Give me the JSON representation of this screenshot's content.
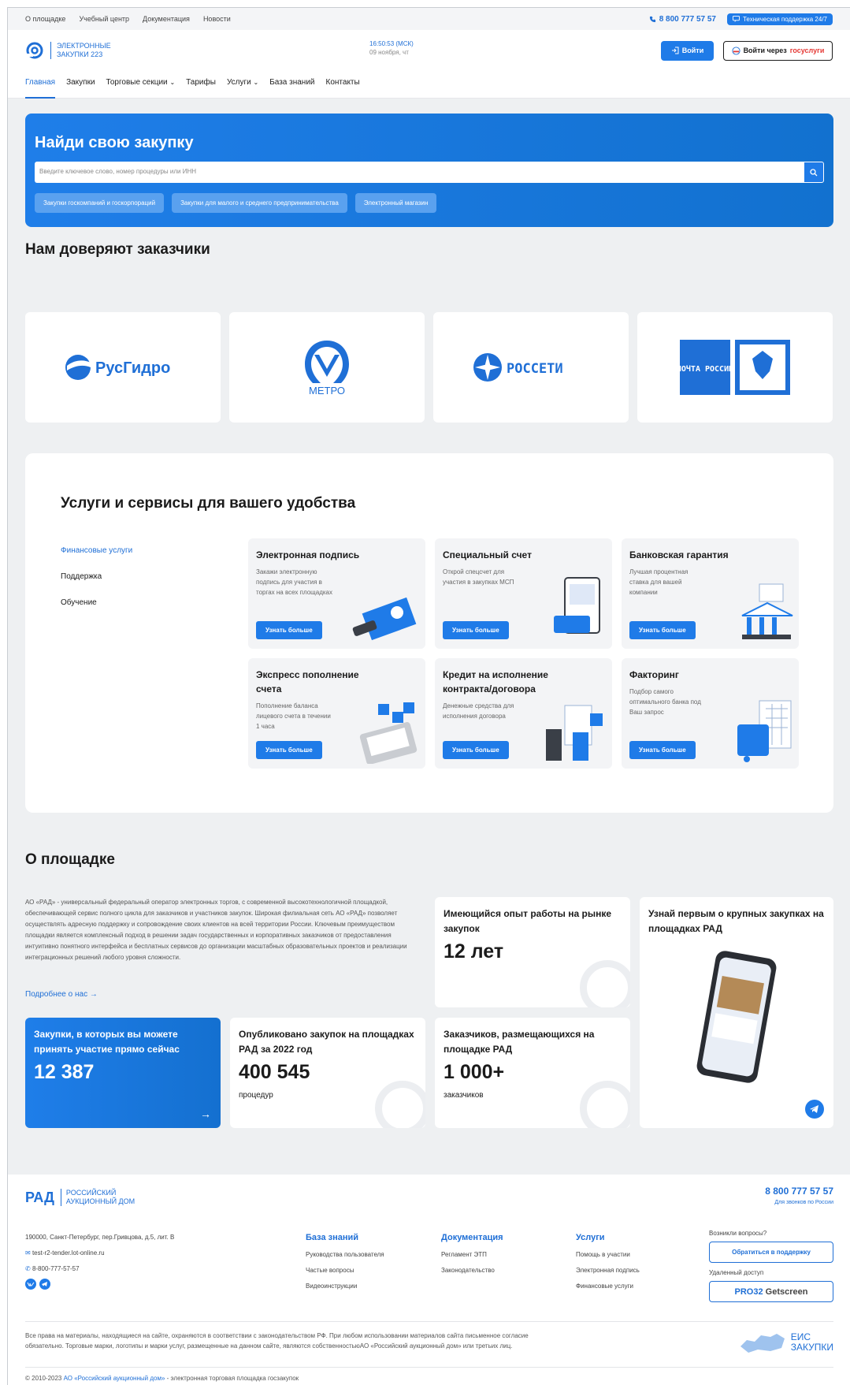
{
  "topbar": {
    "links": [
      "О площадке",
      "Учебный центр",
      "Документация",
      "Новости"
    ],
    "phone": "8 800 777 57 57",
    "support": "Техническая поддержка 24/7"
  },
  "header": {
    "logo_line1": "ЭЛЕКТРОННЫЕ",
    "logo_line2": "ЗАКУПКИ 223",
    "time": "16:50:53 (МСК)",
    "date": "09 ноября, чт",
    "login": "Войти",
    "gos_prefix": "Войти через",
    "gos_brand": "госуслуги"
  },
  "nav": [
    "Главная",
    "Закупки",
    "Торговые секции",
    "Тарифы",
    "Услуги",
    "База знаний",
    "Контакты"
  ],
  "hero": {
    "title": "Найди свою закупку",
    "placeholder": "Введите ключевое слово, номер процедуры или ИНН",
    "chips": [
      "Закупки госкомпаний и госкорпораций",
      "Закупки для малого и среднего предпринимательства",
      "Электронный магазин"
    ]
  },
  "partners": {
    "title": "Нам доверяют заказчики",
    "items": [
      {
        "label": "РусГидро",
        "icon": "rushydro-logo"
      },
      {
        "label": "МЕТРО",
        "icon": "metro-logo"
      },
      {
        "label": "РОССЕТИ",
        "icon": "rosseti-logo"
      },
      {
        "label": "ПОЧТА РОССИИ",
        "icon": "pochta-logo"
      }
    ]
  },
  "services": {
    "title": "Услуги и сервисы для вашего удобства",
    "tabs": [
      "Финансовые услуги",
      "Поддержка",
      "Обучение"
    ],
    "more_label": "Узнать больше",
    "cards": [
      {
        "title": "Электронная подпись",
        "desc": "Закажи электронную подпись для участия в торгах на всех площадках"
      },
      {
        "title": "Специальный счет",
        "desc": "Открой спецсчет для участия в закупках МСП"
      },
      {
        "title": "Банковская гарантия",
        "desc": "Лучшая процентная ставка для вашей компании"
      },
      {
        "title": "Экспресс пополнение счета",
        "desc": "Пополнение баланса лицевого счета в течении 1 часа"
      },
      {
        "title": "Кредит на исполнение контракта/договора",
        "desc": "Денежные средства для исполнения договора"
      },
      {
        "title": "Факторинг",
        "desc": "Подбор самого оптимального банка под Ваш запрос"
      }
    ]
  },
  "about": {
    "title": "О площадке",
    "text": "АО «РАД» - универсальный федеральный оператор электронных торгов, с современной высокотехнологичной площадкой, обеспечивающей сервис полного цикла для заказчиков и участников закупок. Широкая филиальная сеть АО «РАД» позволяет осуществлять адресную поддержку и сопровождение своих клиентов на всей территории России. Ключевым преимуществом площадки является комплексный подход в решении задач государственных и корпоративных заказчиков от предоставления интуитивно понятного интерфейса и бесплатных сервисов до организации масштабных образовательных проектов и реализации интеграционных решений любого уровня сложности.",
    "link": "Подробнее о нас",
    "experience_caption": "Имеющийся опыт работы на рынке закупок",
    "experience_value": "12 лет",
    "promo_caption": "Узнай первым о крупных закупках на площадках РАД",
    "now_caption": "Закупки, в которых вы можете принять участие прямо сейчас",
    "now_value": "12 387",
    "published_caption": "Опубликовано закупок на площадках РАД за 2022 год",
    "published_value": "400 545",
    "published_unit": "процедур",
    "customers_caption": "Заказчиков, размещающихся на площадке РАД",
    "customers_value": "1 000+",
    "customers_unit": "заказчиков"
  },
  "footer": {
    "logo_mark": "РАД",
    "logo_line1": "РОССИЙСКИЙ",
    "logo_line2": "АУКЦИОННЫЙ ДОМ",
    "phone": "8 800 777 57 57",
    "phone_note": "Для звонков по России",
    "address": "190000, Санкт-Петербург, пер.Гривцова, д.5, лит. В",
    "email": "test-r2-tender.lot-online.ru",
    "tel": "8-800-777-57-57",
    "cols": [
      {
        "title": "База знаний",
        "items": [
          "Руководства пользователя",
          "Частые вопросы",
          "Видеоинструкции"
        ]
      },
      {
        "title": "Документация",
        "items": [
          "Регламент ЭТП",
          "Законодательство"
        ]
      },
      {
        "title": "Услуги",
        "items": [
          "Помощь в участии",
          "Электронная подпись",
          "Финансовые услуги"
        ]
      }
    ],
    "questions": "Возникли вопросы?",
    "support_btn": "Обратиться в поддержку",
    "remote": "Удаленный доступ",
    "pro": "PRO32",
    "getscreen": "Getscreen",
    "legal": "Все права на материалы, находящиеся на сайте, охраняются в соответствии с законодательством РФ. При любом использовании материалов сайта письменное согласие обязательно. Торговые марки, логотипы и марки услуг, размещенные на данном сайте, являются собственностьюАО «Российский аукционный дом» или третьих лиц.",
    "eis_line1": "ЕИС",
    "eis_line2": "ЗАКУПКИ",
    "copy_prefix": "© 2010-2023",
    "copy_link": "АО «Российский аукционный дом»",
    "copy_suffix": "- электронная торговая площадка госзакупок"
  }
}
